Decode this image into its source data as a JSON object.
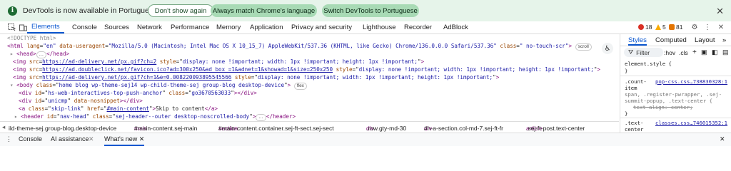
{
  "banner": {
    "message": "DevTools is now available in Portuguese",
    "btn_dont_show": "Don't show again",
    "btn_match": "Always match Chrome's language",
    "btn_switch": "Switch DevTools to Portuguese",
    "close": "✕"
  },
  "toolbar": {
    "tabs": [
      "Elements",
      "Console",
      "Sources",
      "Network",
      "Performance",
      "Memory",
      "Application",
      "Privacy and security",
      "Lighthouse",
      "Recorder",
      "AdBlock"
    ],
    "errors": "18",
    "warnings": "5",
    "issues": "81"
  },
  "dom": {
    "doctype": "<!DOCTYPE html>",
    "html_open_tag": "<html",
    "html_lang_attr": "lang",
    "html_lang_val": "\"en\"",
    "html_ua_attr": "data-useragent",
    "html_ua_val": "\"Mozilla/5.0 (Macintosh; Intel Mac OS X 10_15_7) AppleWebKit/537.36 (KHTML, like Gecko) Chrome/136.0.0.0 Safari/537.36\"",
    "html_class_attr": "class",
    "html_class_val": "\" no-touch-scr\"",
    "scroll_chip": "scroll",
    "head": "<head>",
    "ellipsis": "…",
    "head_close": "</head>",
    "img1_src": "https://ad-delivery.net/px.gif?ch=2",
    "img_style": "display: none !important; width: 1px !important; height: 1px !important;",
    "img2_src": "https://ad.doubleclick.net/favicon.ico?ad=300x250&ad_box_=1&adnet=1&showad=1&size=250x250",
    "img3_src": "https://ad-delivery.net/px.gif?ch=1&e=0.008220093895545566",
    "body_class": "home blog wp-theme-sej14 wp-child-theme-sej group-blog desktop-device",
    "flex_chip": "flex",
    "div1_id": "hs-web-interactives-top-push-anchor",
    "div1_class": "go3670563033",
    "div2_id": "unicmp",
    "div2_attr": "data-nosnippet",
    "a_class": "skip-link",
    "a_href": "#main-content",
    "a_text": "Skip to content",
    "header_id": "nav-head",
    "header_class": "sej-header--outer desktop-noscrolled-body"
  },
  "breadcrumbs": [
    {
      "tag": "",
      "cls": "ild-theme-sej.group-blog.desktop-device"
    },
    {
      "tag": "main",
      "cls": "#main-content.sej-main"
    },
    {
      "tag": "section",
      "cls": "#main-content.container.sej-ft-sect.sej-sect"
    },
    {
      "tag": "div",
      "cls": ".row.gty-md-30"
    },
    {
      "tag": "div",
      "cls": "#h-a-section.col-md-7.sej-ft-fr"
    },
    {
      "tag": "article",
      "cls": ".sej-ft-post.text-center"
    }
  ],
  "drawer": {
    "console": "Console",
    "ai": "AI assistance",
    "whats_new": "What's new",
    "close": "✕"
  },
  "styles": {
    "tabs": [
      "Styles",
      "Computed",
      "Layout"
    ],
    "more": "»",
    "filter": "Filter",
    "hov": ":hov",
    "cls": ".cls",
    "element_style": "element.style {",
    "close_brace": "}",
    "rule1_selector_a": ".count-",
    "rule1_selector_b": "item",
    "rule1_selector_c": "span, .register-pwrapper, .sej-",
    "rule1_selector_d": "summit-popup, .text-center {",
    "rule1_source": "pop-css.css…738830328:1",
    "rule1_prop": "text-align: center;",
    "rule2_selector_a": ".text-",
    "rule2_selector_b": "center",
    "rule2_source": "classes.css…746015352:1"
  }
}
